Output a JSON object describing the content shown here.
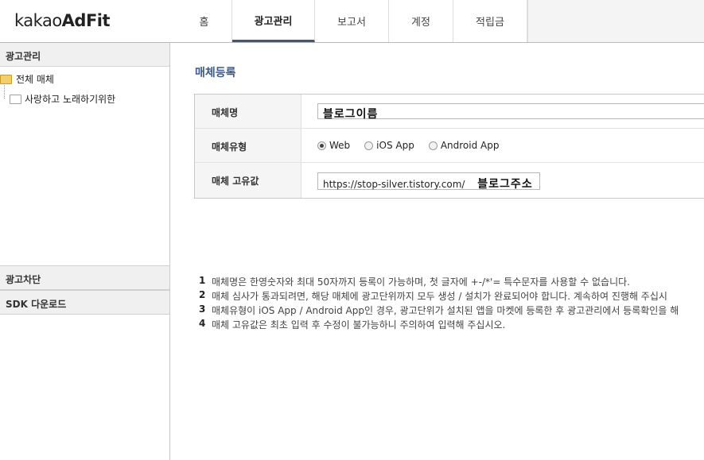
{
  "brand": {
    "logo_light": "kakao",
    "logo_bold": "AdFit"
  },
  "nav": {
    "tabs": [
      {
        "label": "홈",
        "active": false
      },
      {
        "label": "광고관리",
        "active": true
      },
      {
        "label": "보고서",
        "active": false
      },
      {
        "label": "계정",
        "active": false
      },
      {
        "label": "적립금",
        "active": false
      }
    ]
  },
  "sidebar": {
    "header": "광고관리",
    "tree": [
      {
        "label": "전체 매체",
        "icon": "folder-open-icon"
      },
      {
        "label": "사랑하고 노래하기위한",
        "icon": "folder-icon"
      }
    ],
    "sections": [
      "광고차단",
      "SDK 다운로드"
    ]
  },
  "main": {
    "title": "매체등록",
    "form": {
      "name_label": "매체명",
      "name_value": "블로그이름",
      "type_label": "매체유형",
      "type_options": [
        {
          "label": "Web",
          "checked": true
        },
        {
          "label": "iOS App",
          "checked": false
        },
        {
          "label": "Android App",
          "checked": false
        }
      ],
      "unique_label": "매체 고유값",
      "unique_value": "https://stop-silver.tistory.com/",
      "unique_annotation": "블로그주소"
    },
    "notes": [
      {
        "num": "1",
        "text": "매체명은 한영숫자와 최대 50자까지 등록이 가능하며, 첫 글자에 +-/*'= 특수문자를 사용할 수 없습니다."
      },
      {
        "num": "2",
        "text": "매체 심사가 통과되려면, 해당 매체에 광고단위까지 모두 생성 / 설치가 완료되어야 합니다. 계속하여 진행해 주십시"
      },
      {
        "num": "3",
        "text": "매체유형이 iOS App / Android App인 경우, 광고단위가 설치된 앱을 마켓에 등록한 후 광고관리에서 등록확인을 해"
      },
      {
        "num": "4",
        "text": "매체 고유값은 최초 입력 후 수정이 불가능하니 주의하여 입력해 주십시오."
      }
    ]
  }
}
